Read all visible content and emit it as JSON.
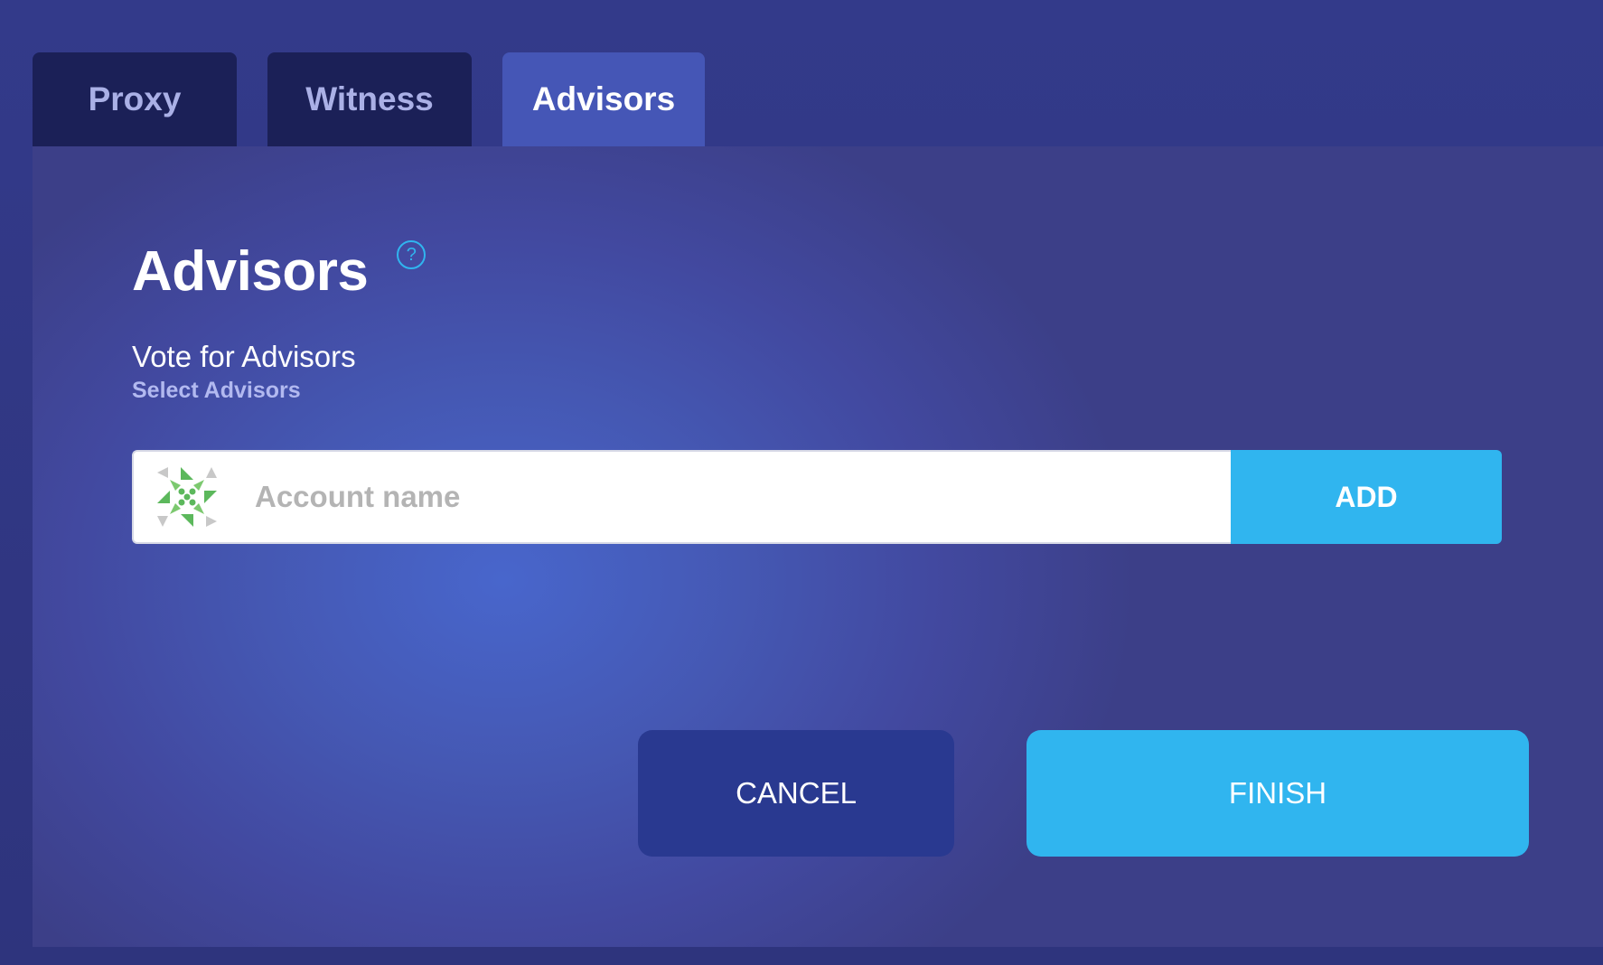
{
  "tabs": [
    {
      "label": "Proxy",
      "active": false
    },
    {
      "label": "Witness",
      "active": false
    },
    {
      "label": "Advisors",
      "active": true
    }
  ],
  "main": {
    "title": "Advisors",
    "help_icon": "question-circle-icon",
    "section_title": "Vote for Advisors",
    "section_subtitle": "Select Advisors",
    "account_input": {
      "placeholder": "Account name",
      "value": "",
      "avatar_icon": "identicon-avatar"
    },
    "add_label": "ADD",
    "cancel_label": "CANCEL",
    "finish_label": "FINISH"
  },
  "colors": {
    "page_background": "#2f3580",
    "tab_inactive": "#1b2057",
    "tab_active": "#4556b6",
    "panel_center": "#4866cc",
    "accent": "#30b5ef",
    "cancel_background": "#293990",
    "help_icon": "#30b5ef",
    "avatar_green": "#5cb85c"
  }
}
